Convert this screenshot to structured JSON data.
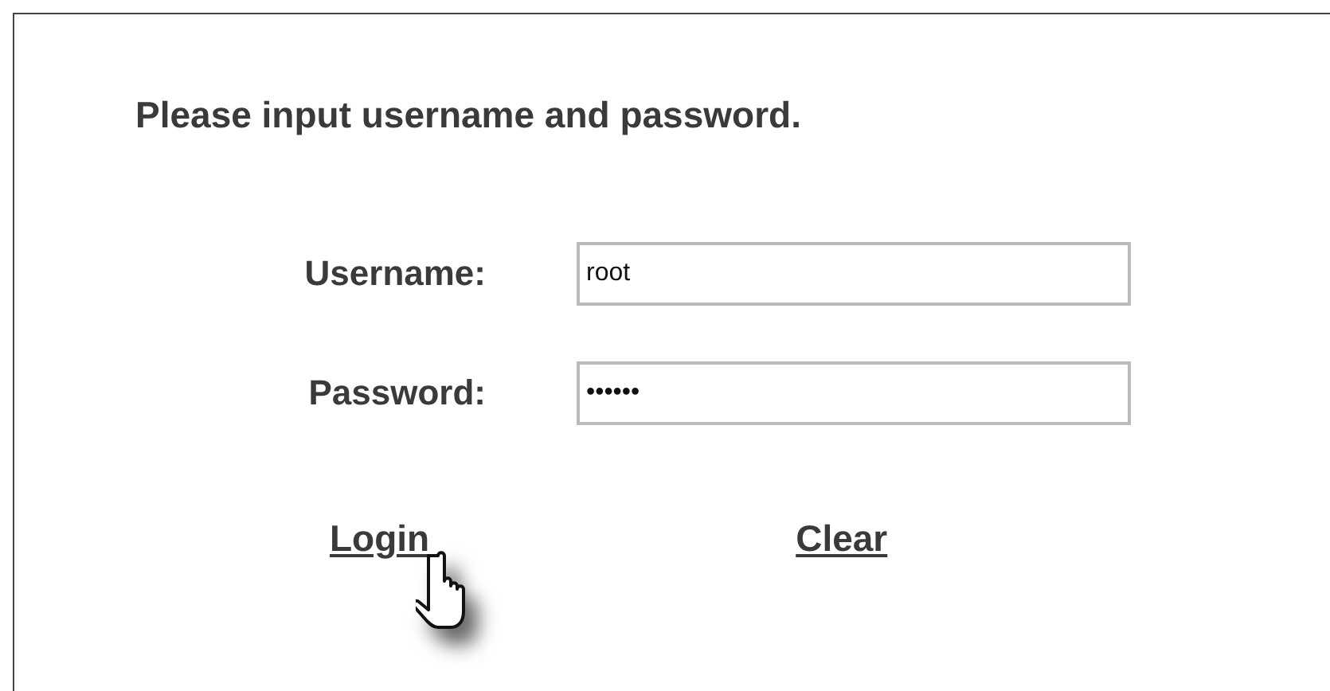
{
  "heading": "Please input username and password.",
  "fields": [
    {
      "label": "Username:",
      "value": "root"
    },
    {
      "label": "Password:",
      "value": "••••••"
    }
  ],
  "links": [
    "Login",
    "Clear"
  ]
}
